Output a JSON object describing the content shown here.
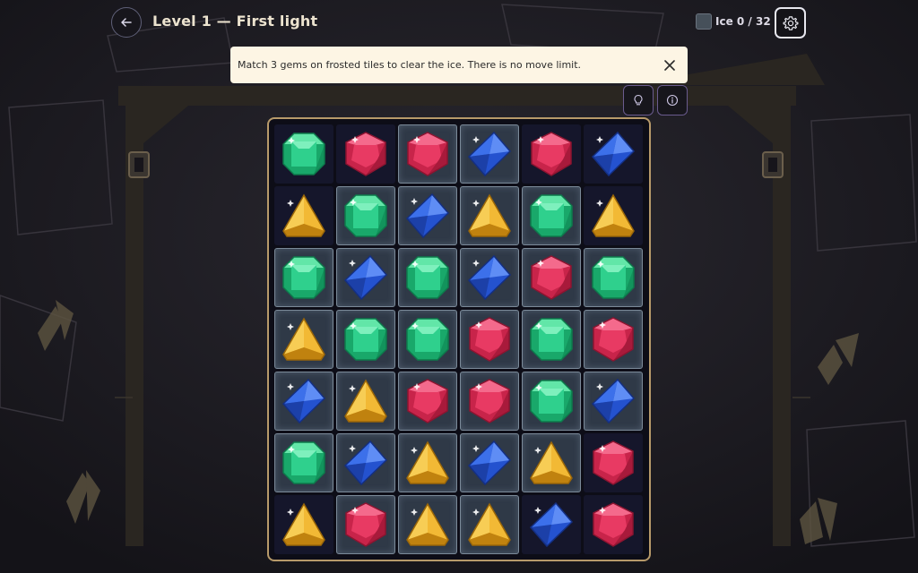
{
  "header": {
    "title": "Level 1 — First light",
    "ice_label": "Ice 0 / 32"
  },
  "banner": {
    "text": "Match 3 gems on frosted tiles to clear the ice. There is no move limit."
  },
  "colors": {
    "green": "#27c982",
    "red": "#e2375e",
    "blue": "#2c5fe0",
    "yellow": "#f0b030",
    "frame": "#b79a6a",
    "ice_tile": "#2f3947"
  },
  "icons": {
    "back": "arrow-left-icon",
    "settings": "gear-icon",
    "close": "close-icon",
    "hint": "lightbulb-icon",
    "info": "info-icon"
  },
  "board": {
    "rows": [
      [
        "green",
        "red",
        "red",
        "blue",
        "red",
        "blue"
      ],
      [
        "yellow",
        "green",
        "blue",
        "yellow",
        "green",
        "yellow"
      ],
      [
        "green",
        "blue",
        "green",
        "blue",
        "red",
        "green"
      ],
      [
        "yellow",
        "green",
        "green",
        "red",
        "green",
        "red"
      ],
      [
        "blue",
        "yellow",
        "red",
        "red",
        "green",
        "blue"
      ],
      [
        "green",
        "blue",
        "yellow",
        "blue",
        "yellow",
        "red"
      ],
      [
        "yellow",
        "red",
        "yellow",
        "yellow",
        "blue",
        "red"
      ]
    ],
    "ice": [
      [
        0,
        0,
        1,
        1,
        0,
        0
      ],
      [
        0,
        1,
        1,
        1,
        1,
        0
      ],
      [
        1,
        1,
        1,
        1,
        1,
        1
      ],
      [
        1,
        1,
        1,
        1,
        1,
        1
      ],
      [
        1,
        1,
        1,
        1,
        1,
        1
      ],
      [
        1,
        1,
        1,
        1,
        1,
        0
      ],
      [
        0,
        1,
        1,
        1,
        0,
        0
      ]
    ]
  }
}
